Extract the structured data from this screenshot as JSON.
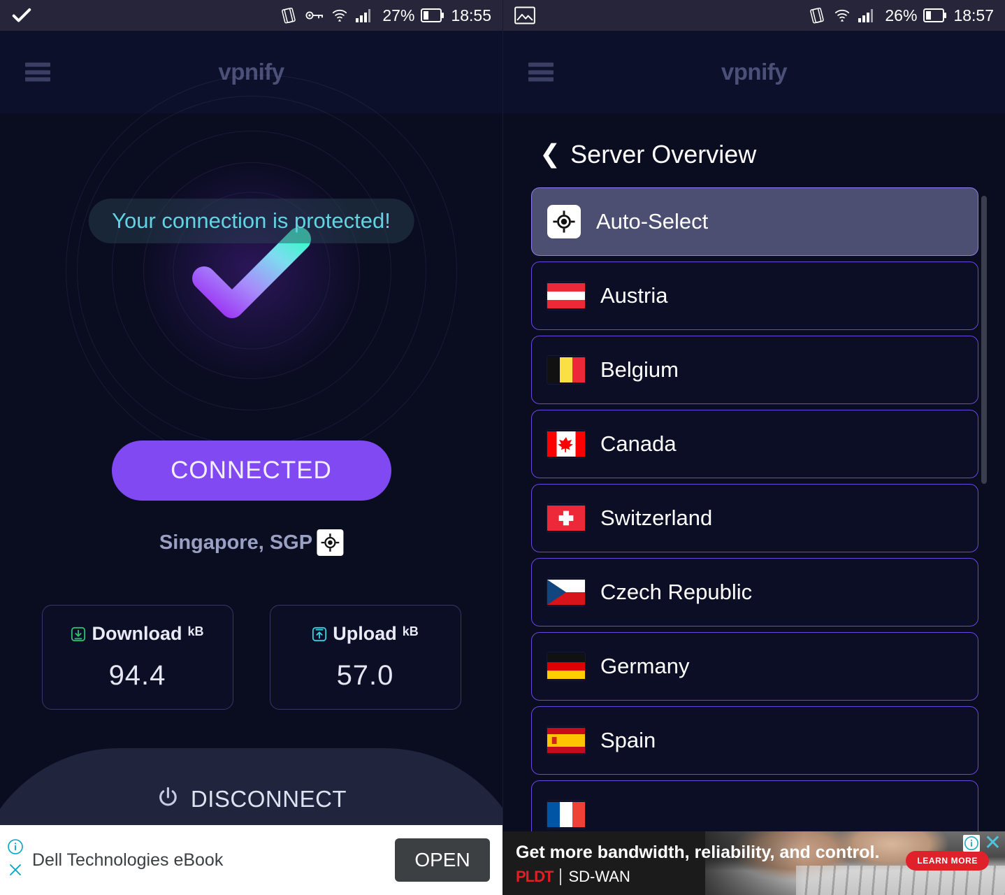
{
  "left": {
    "status_bar": {
      "check_icon": "check-icon",
      "icons": [
        "screen-rotation-icon",
        "vpn-key-icon",
        "wifi-icon",
        "signal-icon"
      ],
      "battery_percent": "27%",
      "battery_icon": "battery-icon",
      "time": "18:55"
    },
    "header": {
      "menu_icon": "hamburger-menu-icon",
      "brand": "vpnify"
    },
    "status_pill": "Your connection is protected!",
    "shield_icon": "checkmark-shield-icon",
    "connect_button": "CONNECTED",
    "location": {
      "text": "Singapore, SGP",
      "icon": "crosshair-location-icon"
    },
    "stats": [
      {
        "icon": "download-arrow-icon",
        "icon_color": "#2fbf71",
        "name": "Download",
        "unit": "kB",
        "value": "94.4"
      },
      {
        "icon": "upload-arrow-icon",
        "icon_color": "#35cfe0",
        "name": "Upload",
        "unit": "kB",
        "value": "57.0"
      }
    ],
    "disconnect": {
      "icon": "power-icon",
      "label": "DISCONNECT"
    },
    "ad": {
      "info_icon": "info-icon",
      "close_icon": "close-icon",
      "text": "Dell Technologies eBook",
      "button": "OPEN"
    }
  },
  "right": {
    "status_bar": {
      "image_icon": "image-icon",
      "icons": [
        "screen-rotation-icon",
        "wifi-icon",
        "signal-icon"
      ],
      "battery_percent": "26%",
      "battery_icon": "battery-icon",
      "time": "18:57"
    },
    "header": {
      "menu_icon": "hamburger-menu-icon",
      "brand": "vpnify"
    },
    "overview": {
      "back_icon": "chevron-left-icon",
      "title": "Server Overview"
    },
    "servers": [
      {
        "label": "Auto-Select",
        "flag": "auto-select-icon",
        "selected": true
      },
      {
        "label": "Austria",
        "flag": "flag-austria",
        "selected": false
      },
      {
        "label": "Belgium",
        "flag": "flag-belgium",
        "selected": false
      },
      {
        "label": "Canada",
        "flag": "flag-canada",
        "selected": false
      },
      {
        "label": "Switzerland",
        "flag": "flag-switzerland",
        "selected": false
      },
      {
        "label": "Czech Republic",
        "flag": "flag-czech",
        "selected": false
      },
      {
        "label": "Germany",
        "flag": "flag-germany",
        "selected": false
      },
      {
        "label": "Spain",
        "flag": "flag-spain",
        "selected": false
      },
      {
        "label": "",
        "flag": "flag-france",
        "selected": false
      }
    ],
    "ad": {
      "headline": "Get more bandwidth, reliability, and control.",
      "brand": "PLDT",
      "product": "SD-WAN",
      "cta": "LEARN MORE",
      "info_icon": "info-icon",
      "close_icon": "close-icon"
    }
  },
  "colors": {
    "background": "#0a0c20",
    "accent_purple": "#8049f2",
    "card_border": "#6b47e0",
    "cyan_text": "#63d2e2",
    "brand_text": "#4b5078"
  }
}
